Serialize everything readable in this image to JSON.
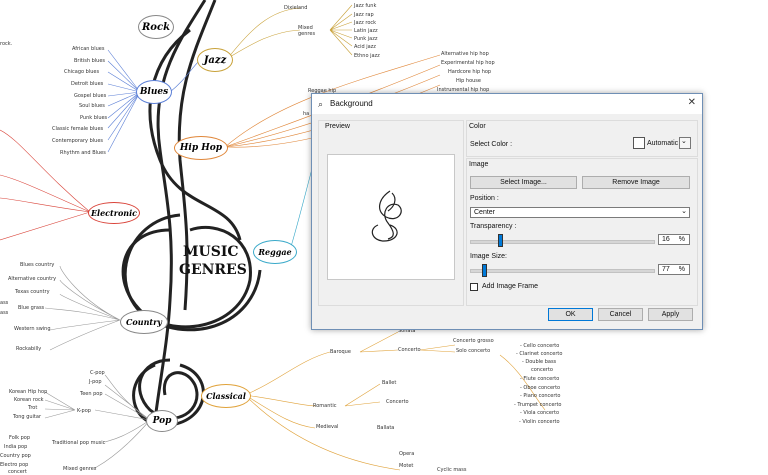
{
  "mindmap": {
    "central": {
      "line1": "MUSIC",
      "line2": "GENRES"
    },
    "genres": {
      "rock": "Rock",
      "jazz": "Jazz",
      "blues": "Blues",
      "hiphop": "Hip Hop",
      "electronic": "Electronic",
      "reggae": "Reggae",
      "country": "Country",
      "pop": "Pop",
      "classical": "Classical"
    },
    "rock_items": [
      "rock."
    ],
    "jazz_items": {
      "dixieland": "Dixieland",
      "mixed": "Mixed genres",
      "mixed_list": [
        "Jazz funk",
        "Jazz rap",
        "Jazz rock",
        "Latin jazz",
        "Punk jazz",
        "Acid jazz",
        "Ethno jazz"
      ]
    },
    "blues_items": [
      "African blues",
      "British blues",
      "Chicago blues",
      "Detroit blues",
      "Gospel blues",
      "Soul blues",
      "Punk blues",
      "Classic female blues",
      "Contemporary blues",
      "Rhythm and Blues"
    ],
    "hiphop_items": [
      "Alternative hip hop",
      "Experimental hip hop",
      "Hardcore hip hop",
      "Hip house",
      "Instrumental hip hop"
    ],
    "country_items": [
      "Blues country",
      "Alternative country",
      "Texas country",
      "Blue grass",
      "Western swing",
      "Rockabilly"
    ],
    "country_fragments": [
      "ass",
      "ass"
    ],
    "pop_items": {
      "cpop": "C-pop",
      "jpop": "J-pop",
      "teen": "Teen pop",
      "kpop": "K-pop",
      "kpop_list": [
        "Korean Hip hop",
        "Korean rock",
        "Trot",
        "Tong guitar"
      ],
      "trad": "Traditional pop music",
      "trad_list": [
        "Folk pop",
        "India pop",
        "Country pop",
        "Electro pop"
      ],
      "mixed": "Mixed genres",
      "trailing": "concert"
    },
    "classical_items": {
      "baroque": "Baroque",
      "sonata": "Sonata",
      "concerto": "Concerto",
      "concerto_grosso": "Concerto grosso",
      "solo_concerto": "Solo concerto",
      "concerto_list": [
        "- Cello concerto",
        "- Clarinet concerto",
        "- Double bass",
        "concerto",
        "- Flute concerto",
        "- Oboe concerto",
        "- Piano concerto",
        "- Trumpet concerto",
        "- Viola concerto",
        "- Violin concerto"
      ],
      "romantic": "Romantic",
      "ballet": "Ballet",
      "concerto2": "Concerto",
      "medieval": "Medieval",
      "ballata": "Ballata",
      "opera": "Opera",
      "motet": "Motet",
      "cyclic_mass": "Cyclic mass"
    },
    "reggae_fragments": [
      "Reggae hip",
      "ha"
    ]
  },
  "dialog": {
    "title": "Background",
    "close_icon": "close-icon",
    "preview_label": "Preview",
    "color_label": "Color",
    "select_color_label": "Select Color :",
    "automatic_label": "Automatic",
    "image_label": "Image",
    "select_image_button": "Select Image...",
    "remove_image_button": "Remove Image",
    "position_label": "Position :",
    "position_value": "Center",
    "transparency_label": "Transparency :",
    "transparency_value": "16",
    "transparency_unit": "%",
    "image_size_label": "Image Size:",
    "image_size_value": "77",
    "image_size_unit": "%",
    "add_frame_label": "Add Image Frame",
    "ok_button": "OK",
    "cancel_button": "Cancel",
    "apply_button": "Apply"
  },
  "colors": {
    "accent": "#007ad9",
    "jazz_branch": "#c9a23a",
    "blues_branch": "#5b7fd6",
    "hiphop_branch": "#e0873a",
    "electronic_branch": "#d9443a",
    "reggae_branch": "#3aa9c9",
    "classical_branch": "#e0a23a"
  }
}
